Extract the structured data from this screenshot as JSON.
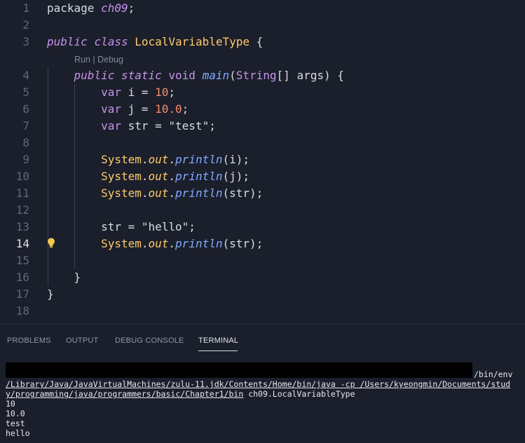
{
  "editor": {
    "codelens": "Run | Debug",
    "lines": [
      {
        "n": "1",
        "tokens": [
          {
            "t": "package "
          },
          {
            "t": "ch09",
            "c": "kwi"
          },
          {
            "t": ";"
          }
        ]
      },
      {
        "n": "2",
        "tokens": []
      },
      {
        "n": "3",
        "tokens": [
          {
            "t": "public",
            "c": "kwi"
          },
          {
            "t": " "
          },
          {
            "t": "class",
            "c": "kwi"
          },
          {
            "t": " "
          },
          {
            "t": "LocalVariableType",
            "c": "cls"
          },
          {
            "t": " {"
          }
        ]
      },
      {
        "n": "4",
        "tokens": [
          {
            "t": "    "
          },
          {
            "t": "public",
            "c": "kwi"
          },
          {
            "t": " "
          },
          {
            "t": "static",
            "c": "kwi"
          },
          {
            "t": " "
          },
          {
            "t": "void",
            "c": "kw"
          },
          {
            "t": " "
          },
          {
            "t": "main",
            "c": "fn"
          },
          {
            "t": "("
          },
          {
            "t": "String",
            "c": "kw"
          },
          {
            "t": "[] args) {"
          }
        ]
      },
      {
        "n": "5",
        "tokens": [
          {
            "t": "        "
          },
          {
            "t": "var",
            "c": "kw"
          },
          {
            "t": " i = "
          },
          {
            "t": "10",
            "c": "num"
          },
          {
            "t": ";"
          }
        ]
      },
      {
        "n": "6",
        "tokens": [
          {
            "t": "        "
          },
          {
            "t": "var",
            "c": "kw"
          },
          {
            "t": " j = "
          },
          {
            "t": "10.0",
            "c": "num"
          },
          {
            "t": ";"
          }
        ]
      },
      {
        "n": "7",
        "tokens": [
          {
            "t": "        "
          },
          {
            "t": "var",
            "c": "kw"
          },
          {
            "t": " str = "
          },
          {
            "t": "\"test\"",
            "c": "str"
          },
          {
            "t": ";"
          }
        ]
      },
      {
        "n": "8",
        "tokens": []
      },
      {
        "n": "9",
        "tokens": [
          {
            "t": "        "
          },
          {
            "t": "System",
            "c": "cls"
          },
          {
            "t": "."
          },
          {
            "t": "out",
            "c": "cls ital"
          },
          {
            "t": "."
          },
          {
            "t": "println",
            "c": "fn"
          },
          {
            "t": "(i);"
          }
        ]
      },
      {
        "n": "10",
        "tokens": [
          {
            "t": "        "
          },
          {
            "t": "System",
            "c": "cls"
          },
          {
            "t": "."
          },
          {
            "t": "out",
            "c": "cls ital"
          },
          {
            "t": "."
          },
          {
            "t": "println",
            "c": "fn"
          },
          {
            "t": "(j);"
          }
        ]
      },
      {
        "n": "11",
        "tokens": [
          {
            "t": "        "
          },
          {
            "t": "System",
            "c": "cls"
          },
          {
            "t": "."
          },
          {
            "t": "out",
            "c": "cls ital"
          },
          {
            "t": "."
          },
          {
            "t": "println",
            "c": "fn"
          },
          {
            "t": "(str);"
          }
        ]
      },
      {
        "n": "12",
        "tokens": []
      },
      {
        "n": "13",
        "tokens": [
          {
            "t": "        str = "
          },
          {
            "t": "\"hello\"",
            "c": "str"
          },
          {
            "t": ";"
          }
        ]
      },
      {
        "n": "14",
        "active": true,
        "tokens": [
          {
            "t": "        "
          },
          {
            "t": "System",
            "c": "cls"
          },
          {
            "t": "."
          },
          {
            "t": "out",
            "c": "cls ital"
          },
          {
            "t": "."
          },
          {
            "t": "println",
            "c": "fn"
          },
          {
            "t": "(str);"
          }
        ]
      },
      {
        "n": "15",
        "tokens": []
      },
      {
        "n": "16",
        "tokens": [
          {
            "t": "    }"
          }
        ]
      },
      {
        "n": "17",
        "tokens": [
          {
            "t": "}"
          }
        ]
      },
      {
        "n": "18",
        "tokens": []
      }
    ]
  },
  "panel": {
    "tabs": [
      "PROBLEMS",
      "OUTPUT",
      "DEBUG CONSOLE",
      "TERMINAL"
    ],
    "active_tab": "TERMINAL",
    "terminal": {
      "line1_tail": "/bin/env",
      "line2": "/Library/Java/JavaVirtualMachines/zulu-11.jdk/Contents/Home/bin/java -cp /Users/kyeongmin/Documents/stud",
      "line3_path": "y/programming/java/programmers/basic/Chapter1/bin",
      "line3_class": " ch09.LocalVariableType",
      "output": [
        "10",
        "10.0",
        "test",
        "hello"
      ]
    }
  },
  "colors": {
    "background": "#1b1f2b",
    "keyword": "#c792ea",
    "class": "#ffcb6b",
    "function": "#82aaff",
    "number": "#f78c6c"
  }
}
